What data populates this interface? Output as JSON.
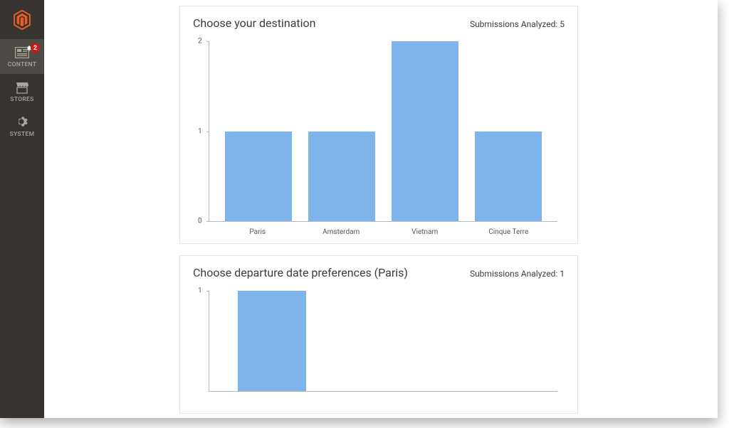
{
  "sidebar": {
    "items": [
      {
        "label": "CONTENT",
        "icon": "content-icon",
        "badge": 2,
        "active": true
      },
      {
        "label": "STORES",
        "icon": "stores-icon"
      },
      {
        "label": "SYSTEM",
        "icon": "system-icon"
      }
    ]
  },
  "cards": [
    {
      "title": "Choose your destination",
      "submissions_label": "Submissions Analyzed: 5"
    },
    {
      "title": "Choose departure date preferences (Paris)",
      "submissions_label": "Submissions Analyzed: 1"
    }
  ],
  "chart_data": [
    {
      "type": "bar",
      "title": "Choose your destination",
      "categories": [
        "Paris",
        "Amsterdam",
        "Vietnam",
        "Cinque Terre"
      ],
      "values": [
        1,
        1,
        2,
        1
      ],
      "xlabel": "",
      "ylabel": "",
      "ylim": [
        0,
        2
      ],
      "yticks": [
        0,
        1,
        2
      ]
    },
    {
      "type": "bar",
      "title": "Choose departure date preferences (Paris)",
      "categories": [
        ""
      ],
      "values": [
        1
      ],
      "xlabel": "",
      "ylabel": "",
      "ylim": [
        0,
        1
      ],
      "yticks": [
        1
      ],
      "visible_bars": 1,
      "slot_count": 3
    }
  ],
  "colors": {
    "sidebar_bg": "#373330",
    "accent": "#e04f00",
    "bar": "#7eb3eb",
    "badge": "#d11a0f"
  }
}
